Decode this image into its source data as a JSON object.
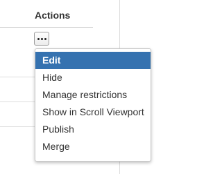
{
  "table": {
    "header": "Actions"
  },
  "actions_button": {
    "icon": "more-dots-icon"
  },
  "menu": {
    "items": [
      {
        "label": "Edit",
        "active": true
      },
      {
        "label": "Hide",
        "active": false
      },
      {
        "label": "Manage restrictions",
        "active": false
      },
      {
        "label": "Show in Scroll Viewport",
        "active": false
      },
      {
        "label": "Publish",
        "active": false
      },
      {
        "label": "Merge",
        "active": false
      }
    ]
  },
  "colors": {
    "highlight": "#3572b0",
    "text": "#333333"
  }
}
